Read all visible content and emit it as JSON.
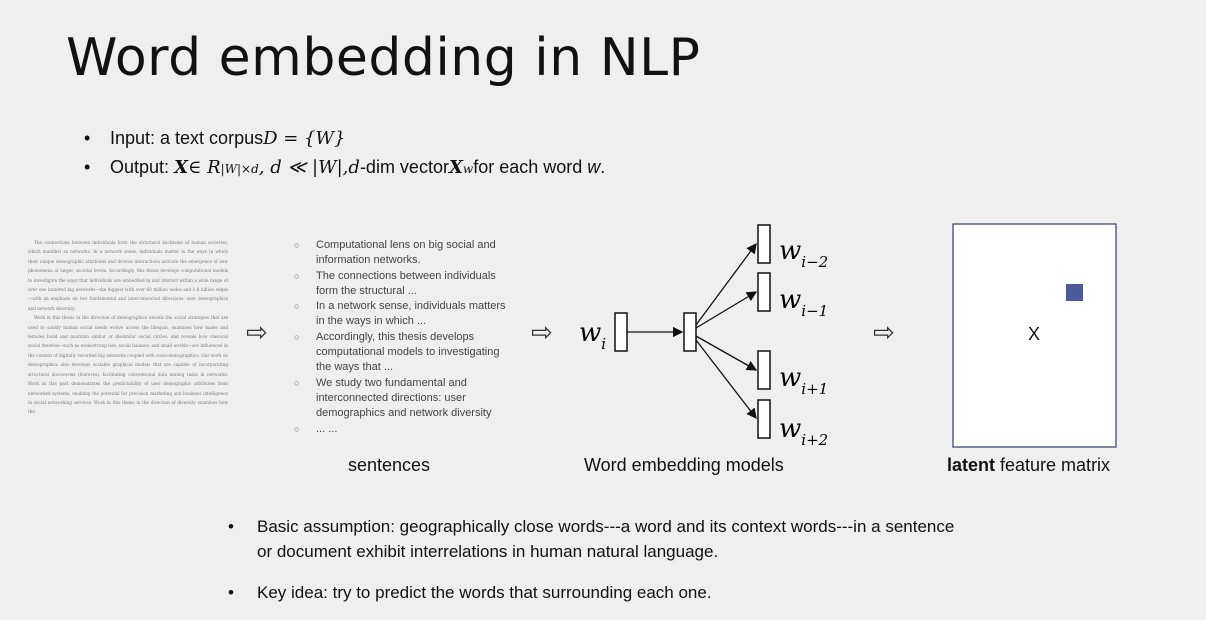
{
  "title": "Word embedding in NLP",
  "bullets_top": {
    "input_prefix": "Input: a text corpus ",
    "input_math": "D = {W}",
    "output_prefix": "Output: ",
    "output_X": "X",
    "output_in": " ∈ R",
    "output_sup": "|W|×d",
    "output_mid": ", d ≪ |W|, ",
    "output_d": "d",
    "output_dim": "-dim vector ",
    "output_Xw": "X",
    "output_w_sub": "w",
    "output_suffix": " for each word ",
    "output_word": "w",
    "output_end": "."
  },
  "doc_paragraphs": [
    "The connections between individuals form the structural backbone of human societies, which manifest as networks. In a network sense, individuals matter in the ways in which their unique demographic attributes and diverse interactions activate the emergence of new phenomena at larger, societal levels. Accordingly, this thesis develops computational models to investigate the ways that individuals are embedded in and interact within a wide range of over one hundred big networks—the biggest with over 60 million nodes and 1.8 billion edges—with an emphasis on two fundamental and interconnected directions: user demographics and network diversity.",
    "Work in this thesis in the direction of demographics unveils the social strategies that are used to satisfy human social needs evolve across the lifespan, examines how males and females build and maintain similar or dissimilar social circles, and reveals how classical social theories—such as weak/strong ties, social balance, and small worlds—are influenced in the context of digitally recorded big networks coupled with socio-demographics. Our work on demographics also develops scalable graphical models that are capable of incorporating structural discoveries (features), facilitating conventional data mining tasks in networks. Work in this part demonstrates the predictability of user demographic attributes from networked systems, enabling the potential for precision marketing and business intelligence in social networking services. Work in this thesis in the direction of diversity examines how the"
  ],
  "sentences": [
    "Computational lens on big social and information networks.",
    "The connections between individuals form the structural ...",
    "In a network sense, individuals matters in the ways in which ...",
    "Accordingly, this thesis develops computational models to investigating the ways that ...",
    "We study two fundamental and interconnected directions: user demographics and network diversity",
    "... ..."
  ],
  "sentence_bullet": "○",
  "arrow_glyph": "⇨",
  "diagram": {
    "input_word": "w",
    "input_sub": "i",
    "outputs": [
      {
        "w": "w",
        "sub": "i−2"
      },
      {
        "w": "w",
        "sub": "i−1"
      },
      {
        "w": "w",
        "sub": "i+1"
      },
      {
        "w": "w",
        "sub": "i+2"
      }
    ]
  },
  "matrix_label": "X",
  "captions": {
    "sentences": "sentences",
    "models": "Word embedding models",
    "latent_bold": "latent",
    "latent_rest": " feature matrix"
  },
  "bullets_bottom": [
    "Basic assumption: geographically close words---a word and its context words---in a sentence or document exhibit interrelations in human natural language.",
    "Key idea: try to predict the words that surrounding each one."
  ],
  "bullet_char": "•",
  "colors": {
    "matrix_square": "#4a5a9a",
    "matrix_border": "#3b4a7a"
  }
}
